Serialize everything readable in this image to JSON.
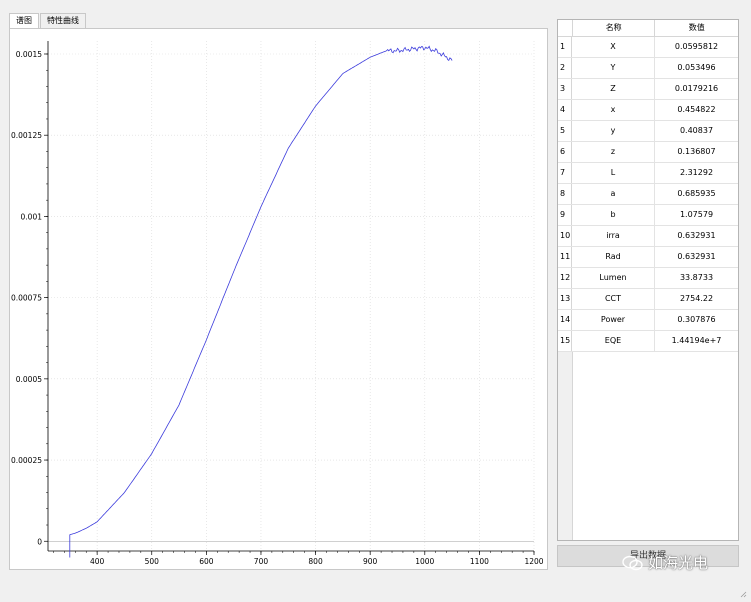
{
  "tabs": [
    {
      "label": "谱图",
      "active": true
    },
    {
      "label": "特性曲线",
      "active": false
    }
  ],
  "chart_data": {
    "type": "line",
    "xlim": [
      310,
      1200
    ],
    "ylim": [
      -3e-05,
      0.00154
    ],
    "xticks": [
      400,
      500,
      600,
      700,
      800,
      900,
      1000,
      1100,
      1200
    ],
    "yticks": [
      {
        "value": 0,
        "label": "0"
      },
      {
        "value": 0.00025,
        "label": "0.00025"
      },
      {
        "value": 0.0005,
        "label": "0.0005"
      },
      {
        "value": 0.00075,
        "label": "0.00075"
      },
      {
        "value": 0.001,
        "label": "0.001"
      },
      {
        "value": 0.00125,
        "label": "0.00125"
      },
      {
        "value": 0.0015,
        "label": "0.0015"
      }
    ],
    "grid": true,
    "line_color": "#3c3cdc",
    "series": [
      {
        "x": [
          350,
          350,
          360,
          380,
          400,
          450,
          500,
          550,
          600,
          650,
          700,
          750,
          800,
          850,
          900,
          930,
          950,
          1000,
          1020,
          1050
        ],
        "y": [
          -5e-05,
          2e-05,
          2.5e-05,
          4e-05,
          6e-05,
          0.00015,
          0.00027,
          0.00042,
          0.00062,
          0.00083,
          0.00103,
          0.00121,
          0.00134,
          0.00144,
          0.00149,
          0.00151,
          0.00151,
          0.00152,
          0.00151,
          0.00148
        ]
      }
    ]
  },
  "table": {
    "headers": [
      "名称",
      "数值"
    ],
    "rows": [
      {
        "index": "1",
        "name": "X",
        "value": "0.0595812"
      },
      {
        "index": "2",
        "name": "Y",
        "value": "0.053496"
      },
      {
        "index": "3",
        "name": "Z",
        "value": "0.0179216"
      },
      {
        "index": "4",
        "name": "x",
        "value": "0.454822"
      },
      {
        "index": "5",
        "name": "y",
        "value": "0.40837"
      },
      {
        "index": "6",
        "name": "z",
        "value": "0.136807"
      },
      {
        "index": "7",
        "name": "L",
        "value": "2.31292"
      },
      {
        "index": "8",
        "name": "a",
        "value": "0.685935"
      },
      {
        "index": "9",
        "name": "b",
        "value": "1.07579"
      },
      {
        "index": "10",
        "name": "irra",
        "value": "0.632931"
      },
      {
        "index": "11",
        "name": "Rad",
        "value": "0.632931"
      },
      {
        "index": "12",
        "name": "Lumen",
        "value": "33.8733"
      },
      {
        "index": "13",
        "name": "CCT",
        "value": "2754.22"
      },
      {
        "index": "14",
        "name": "Power",
        "value": "0.307876"
      },
      {
        "index": "15",
        "name": "EQE",
        "value": "1.44194e+7"
      }
    ]
  },
  "export_button": {
    "label": "导出数据"
  },
  "watermark": {
    "text": "如海光电",
    "icon": "wechat-icon"
  }
}
